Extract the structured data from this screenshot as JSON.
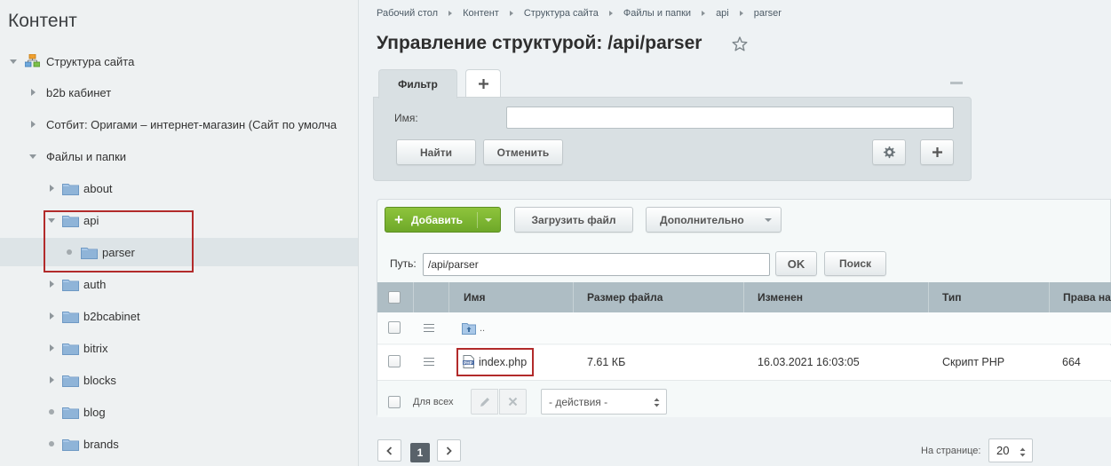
{
  "sidebar": {
    "title": "Контент",
    "tree": [
      {
        "label": "Структура сайта"
      },
      {
        "label": "b2b кабинет"
      },
      {
        "label": "Сотбит: Оригами – интернет-магазин (Сайт по умолча"
      },
      {
        "label": "Файлы и папки"
      },
      {
        "label": "about"
      },
      {
        "label": "api"
      },
      {
        "label": "parser"
      },
      {
        "label": "auth"
      },
      {
        "label": "b2bcabinet"
      },
      {
        "label": "bitrix"
      },
      {
        "label": "blocks"
      },
      {
        "label": "blog"
      },
      {
        "label": "brands"
      }
    ]
  },
  "breadcrumb": [
    "Рабочий стол",
    "Контент",
    "Структура сайта",
    "Файлы и папки",
    "api",
    "parser"
  ],
  "page": {
    "title": "Управление структурой: /api/parser"
  },
  "filter": {
    "tab_label": "Фильтр",
    "name_label": "Имя:",
    "name_value": "",
    "find_button": "Найти",
    "cancel_button": "Отменить"
  },
  "toolbar": {
    "add_button": "Добавить",
    "upload_button": "Загрузить файл",
    "more_button": "Дополнительно"
  },
  "path": {
    "label": "Путь:",
    "value": "/api/parser",
    "ok_button": "OK",
    "search_button": "Поиск"
  },
  "grid": {
    "columns": [
      "Имя",
      "Размер файла",
      "Изменен",
      "Тип",
      "Права на"
    ],
    "up_row_label": "..",
    "rows": [
      {
        "name": "index.php",
        "size": "7.61 КБ",
        "modified": "16.03.2021 16:03:05",
        "type": "Скрипт PHP",
        "rights": "664"
      }
    ]
  },
  "footer": {
    "for_all_label": "Для всех",
    "actions_select": "- действия -"
  },
  "pager": {
    "current_page": "1",
    "per_page_label": "На странице:",
    "per_page_value": "20"
  },
  "colors": {
    "accent_green": "#7ab833",
    "highlight_border": "#b22b2b",
    "grid_header": "#aebdc4",
    "folder": "#8fb4d8"
  }
}
